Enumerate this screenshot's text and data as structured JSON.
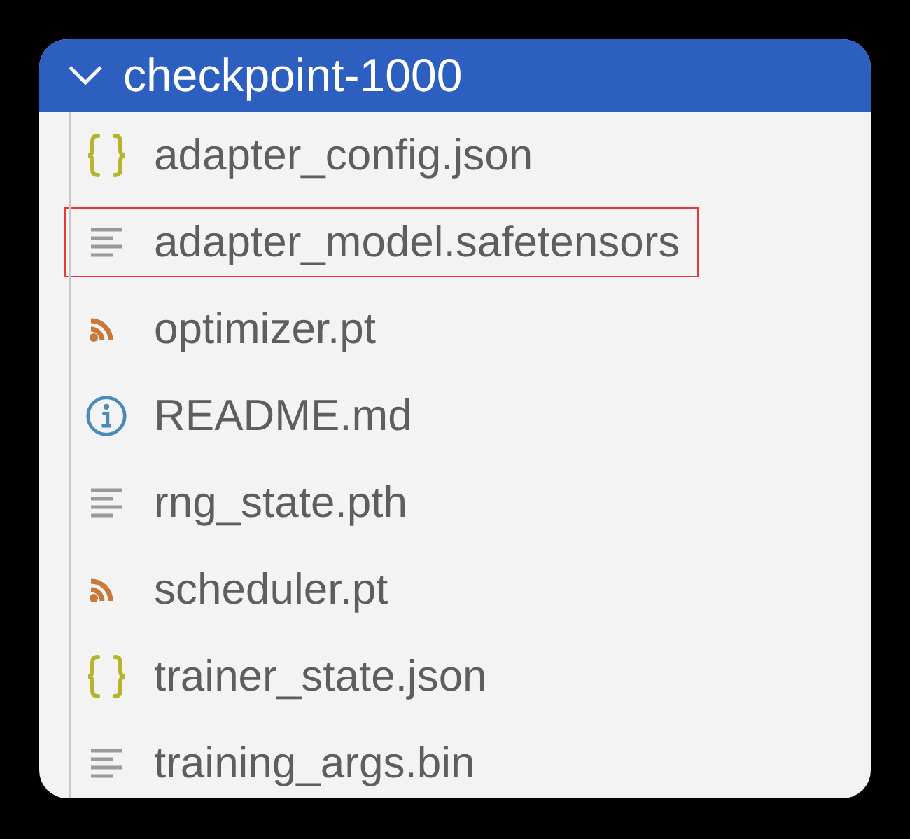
{
  "folder": {
    "name": "checkpoint-1000",
    "expanded": true
  },
  "files": [
    {
      "name": "adapter_config.json",
      "kind": "json",
      "highlighted": false
    },
    {
      "name": "adapter_model.safetensors",
      "kind": "text",
      "highlighted": true
    },
    {
      "name": "optimizer.pt",
      "kind": "rss",
      "highlighted": false
    },
    {
      "name": "README.md",
      "kind": "info",
      "highlighted": false
    },
    {
      "name": "rng_state.pth",
      "kind": "text",
      "highlighted": false
    },
    {
      "name": "scheduler.pt",
      "kind": "rss",
      "highlighted": false
    },
    {
      "name": "trainer_state.json",
      "kind": "json",
      "highlighted": false
    },
    {
      "name": "training_args.bin",
      "kind": "text",
      "highlighted": false
    }
  ]
}
